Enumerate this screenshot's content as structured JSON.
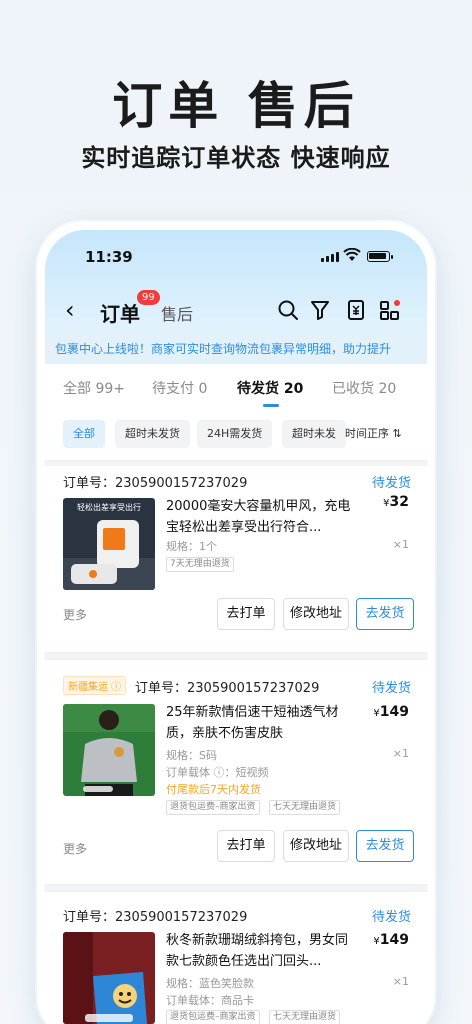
{
  "hero": {
    "title": "订单 售后",
    "subtitle": "实时追踪订单状态 快速响应"
  },
  "status_bar": {
    "time": "11:39"
  },
  "nav": {
    "back": "‹",
    "title": "订单",
    "badge": "99",
    "after_sales": "售后"
  },
  "banner": "包裹中心上线啦！商家可实时查询物流包裹异常明细，助力提升",
  "tabs": [
    {
      "label": "全部 99+",
      "active": false
    },
    {
      "label": "待支付 0",
      "active": false
    },
    {
      "label": "待发货 20",
      "active": true
    },
    {
      "label": "已收货 20",
      "active": false
    }
  ],
  "filters": [
    "全部",
    "超时未发货",
    "24H需发货",
    "超时未发"
  ],
  "sort_label": "时间正序 ⇅",
  "orders": [
    {
      "order_no": "订单号：2305900157237029",
      "status": "待发货",
      "title": "20000毫安大容量机甲风，充电宝轻松出差享受出行符合...",
      "price_symbol": "¥",
      "price": "32",
      "qty": "×1",
      "spec": "规格：1个",
      "tags": [
        "7天无理由退货"
      ],
      "more": "更多",
      "buttons": [
        "去打单",
        "修改地址",
        "去发货"
      ]
    },
    {
      "region_tag": "新疆集运 ⓘ",
      "order_no": "订单号：2305900157237029",
      "status": "待发货",
      "title": "25年新款情侣速干短袖透气材质，亲肤不伤害皮肤",
      "price_symbol": "¥",
      "price": "149",
      "qty": "×1",
      "spec": "规格：S码",
      "carrier": "订单载体 ⓘ：短视频",
      "ship_note": "付尾款后7天内发货",
      "tags": [
        "退货包运费–商家出资",
        "七天无理由退货"
      ],
      "more": "更多",
      "buttons": [
        "去打单",
        "修改地址",
        "去发货"
      ]
    },
    {
      "order_no": "订单号：2305900157237029",
      "status": "待发货",
      "title": "秋冬新款珊瑚绒斜挎包，男女同款七款颜色任选出门回头...",
      "price_symbol": "¥",
      "price": "149",
      "qty": "×1",
      "spec": "规格：蓝色笑脸款",
      "carrier": "订单载体：商品卡",
      "tags": [
        "退货包运费–商家出资",
        "七天无理由退货"
      ]
    }
  ],
  "thumb1_text": "轻松出差享受出行",
  "colors": {
    "accent": "#2b8de0",
    "badge": "#f23c3c",
    "warning": "#f5a623"
  }
}
